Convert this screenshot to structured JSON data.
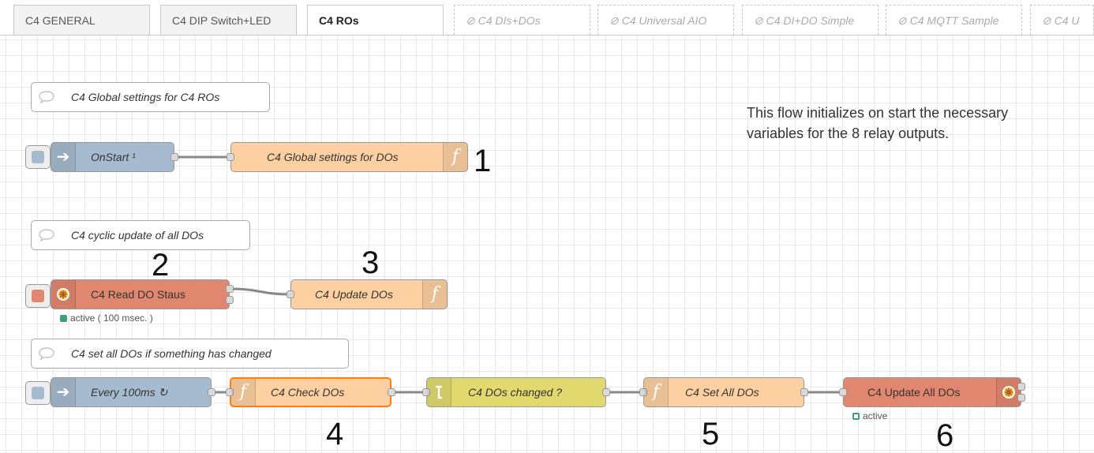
{
  "tabs": [
    {
      "label": "C4 GENERAL",
      "state": "normal"
    },
    {
      "label": "C4 DIP Switch+LED",
      "state": "normal"
    },
    {
      "label": "C4 ROs",
      "state": "active"
    },
    {
      "label": "⊘ C4 DIs+DOs",
      "state": "disabled"
    },
    {
      "label": "⊘ C4 Universal AIO",
      "state": "disabled"
    },
    {
      "label": "⊘ C4 DI+DO Simple",
      "state": "disabled"
    },
    {
      "label": "⊘ C4 MQTT Sample",
      "state": "disabled"
    },
    {
      "label": "⊘ C4 U",
      "state": "disabled"
    }
  ],
  "comments": {
    "global": "C4 Global settings for C4 ROs",
    "cyclic": "C4 cyclic update of all DOs",
    "setall": "C4 set all DOs if something has changed"
  },
  "nodes": {
    "onstart": "OnStart ¹",
    "global_settings": "C4 Global settings for DOs",
    "read_do": "C4 Read DO Staus",
    "read_do_status": "active ( 100 msec. )",
    "update_dos": "C4 Update DOs",
    "every100": "Every 100ms ↻",
    "check_dos": "C4 Check DOs",
    "dos_changed": "C4 DOs changed ?",
    "set_all": "C4 Set All DOs",
    "update_all": "C4 Update All DOs",
    "update_all_status": "active"
  },
  "annotations": {
    "n1": "1",
    "n2": "2",
    "n3": "3",
    "n4": "4",
    "n5": "5",
    "n6": "6"
  },
  "note": {
    "line1": "This flow initializes on start the necessary",
    "line2": "variables for the 8 relay outputs."
  },
  "colors": {
    "inject": "#a6bbcf",
    "function": "#fdd0a2",
    "modbus": "#e2876f",
    "switch": "#e2d96e",
    "selected": "#ff7f0e",
    "status_green": "#3e9f78"
  },
  "icons": {
    "inject": "arrow-right-icon",
    "function": "function-icon",
    "modbus": "gear-icon",
    "switch": "switch-icon",
    "comment": "comment-icon"
  }
}
